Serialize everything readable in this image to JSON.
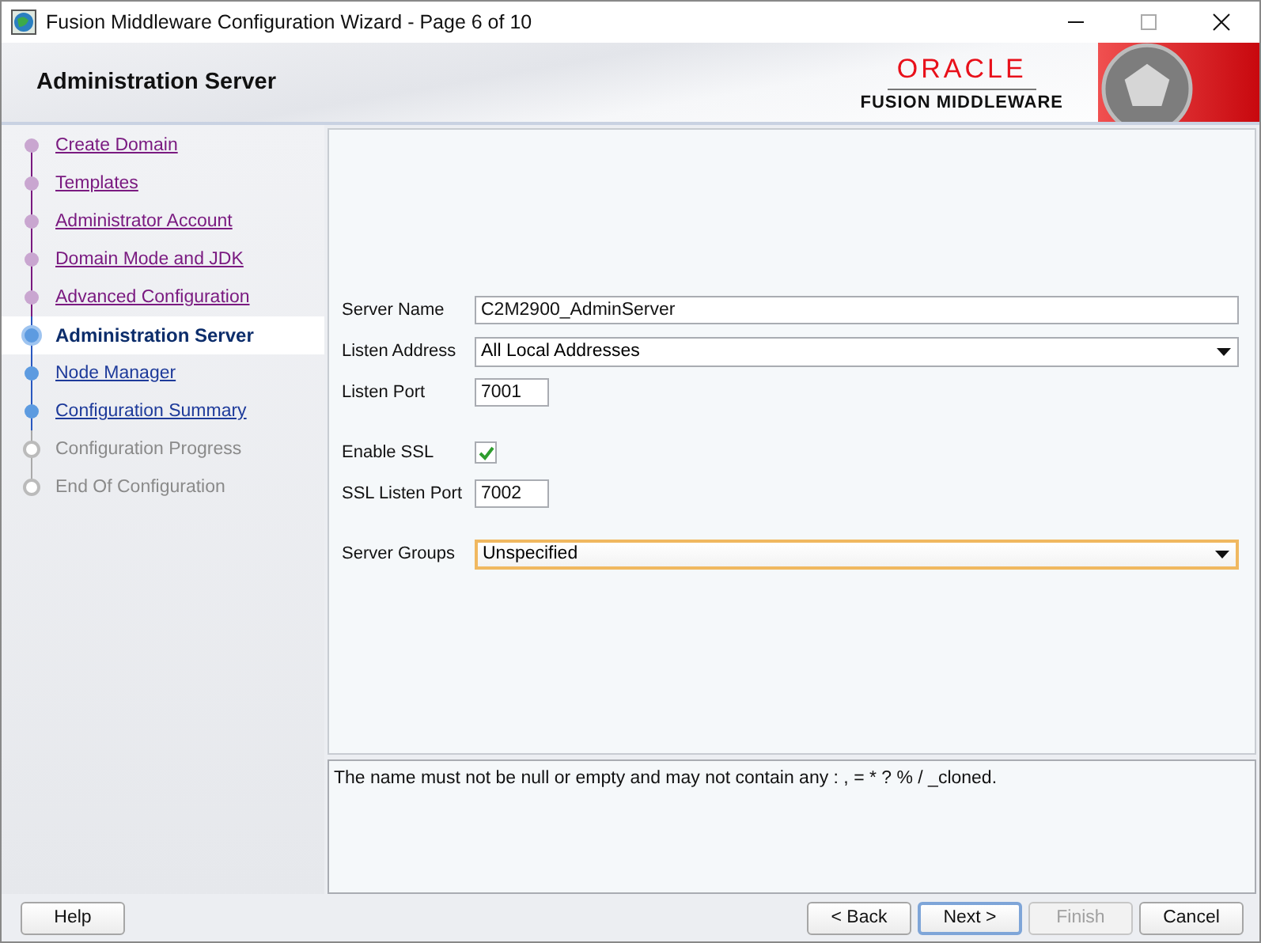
{
  "window": {
    "title": "Fusion Middleware Configuration Wizard - Page 6 of 10"
  },
  "header": {
    "title": "Administration Server",
    "brand": "ORACLE",
    "product": "FUSION MIDDLEWARE"
  },
  "steps": [
    {
      "label": "Create Domain",
      "selected": false,
      "visited": true,
      "disabled": false
    },
    {
      "label": "Templates",
      "selected": false,
      "visited": true,
      "disabled": false
    },
    {
      "label": "Administrator Account",
      "selected": false,
      "visited": true,
      "disabled": false
    },
    {
      "label": "Domain Mode and JDK",
      "selected": false,
      "visited": true,
      "disabled": false
    },
    {
      "label": "Advanced Configuration",
      "selected": false,
      "visited": true,
      "disabled": false
    },
    {
      "label": "Administration Server",
      "selected": true,
      "visited": false,
      "disabled": false
    },
    {
      "label": "Node Manager",
      "selected": false,
      "visited": false,
      "disabled": false
    },
    {
      "label": "Configuration Summary",
      "selected": false,
      "visited": false,
      "disabled": false
    },
    {
      "label": "Configuration Progress",
      "selected": false,
      "visited": false,
      "disabled": true
    },
    {
      "label": "End Of Configuration",
      "selected": false,
      "visited": false,
      "disabled": true
    }
  ],
  "field_groups": [
    [
      {
        "label": "Server Name",
        "kind": "text",
        "value": "C2M2900_AdminServer"
      },
      {
        "label": "Listen Address",
        "kind": "combo",
        "value": "All Local Addresses",
        "focused": false
      },
      {
        "label": "Listen Port",
        "kind": "number",
        "value": "7001"
      }
    ],
    [
      {
        "label": "Enable SSL",
        "kind": "checkbox",
        "checked": true
      },
      {
        "label": "SSL Listen Port",
        "kind": "number",
        "value": "7002"
      }
    ],
    [
      {
        "label": "Server Groups",
        "kind": "combo",
        "value": "Unspecified",
        "focused": true
      }
    ]
  ],
  "message": "The name must not be null or empty and may not contain any : , = * ? % / _cloned.",
  "help_button": "Help",
  "buttons": [
    {
      "label": "< Back",
      "disabled": false,
      "default": false
    },
    {
      "label": "Next >",
      "disabled": false,
      "default": true
    },
    {
      "label": "Finish",
      "disabled": true,
      "default": false
    },
    {
      "label": "Cancel",
      "disabled": false,
      "default": false
    }
  ]
}
